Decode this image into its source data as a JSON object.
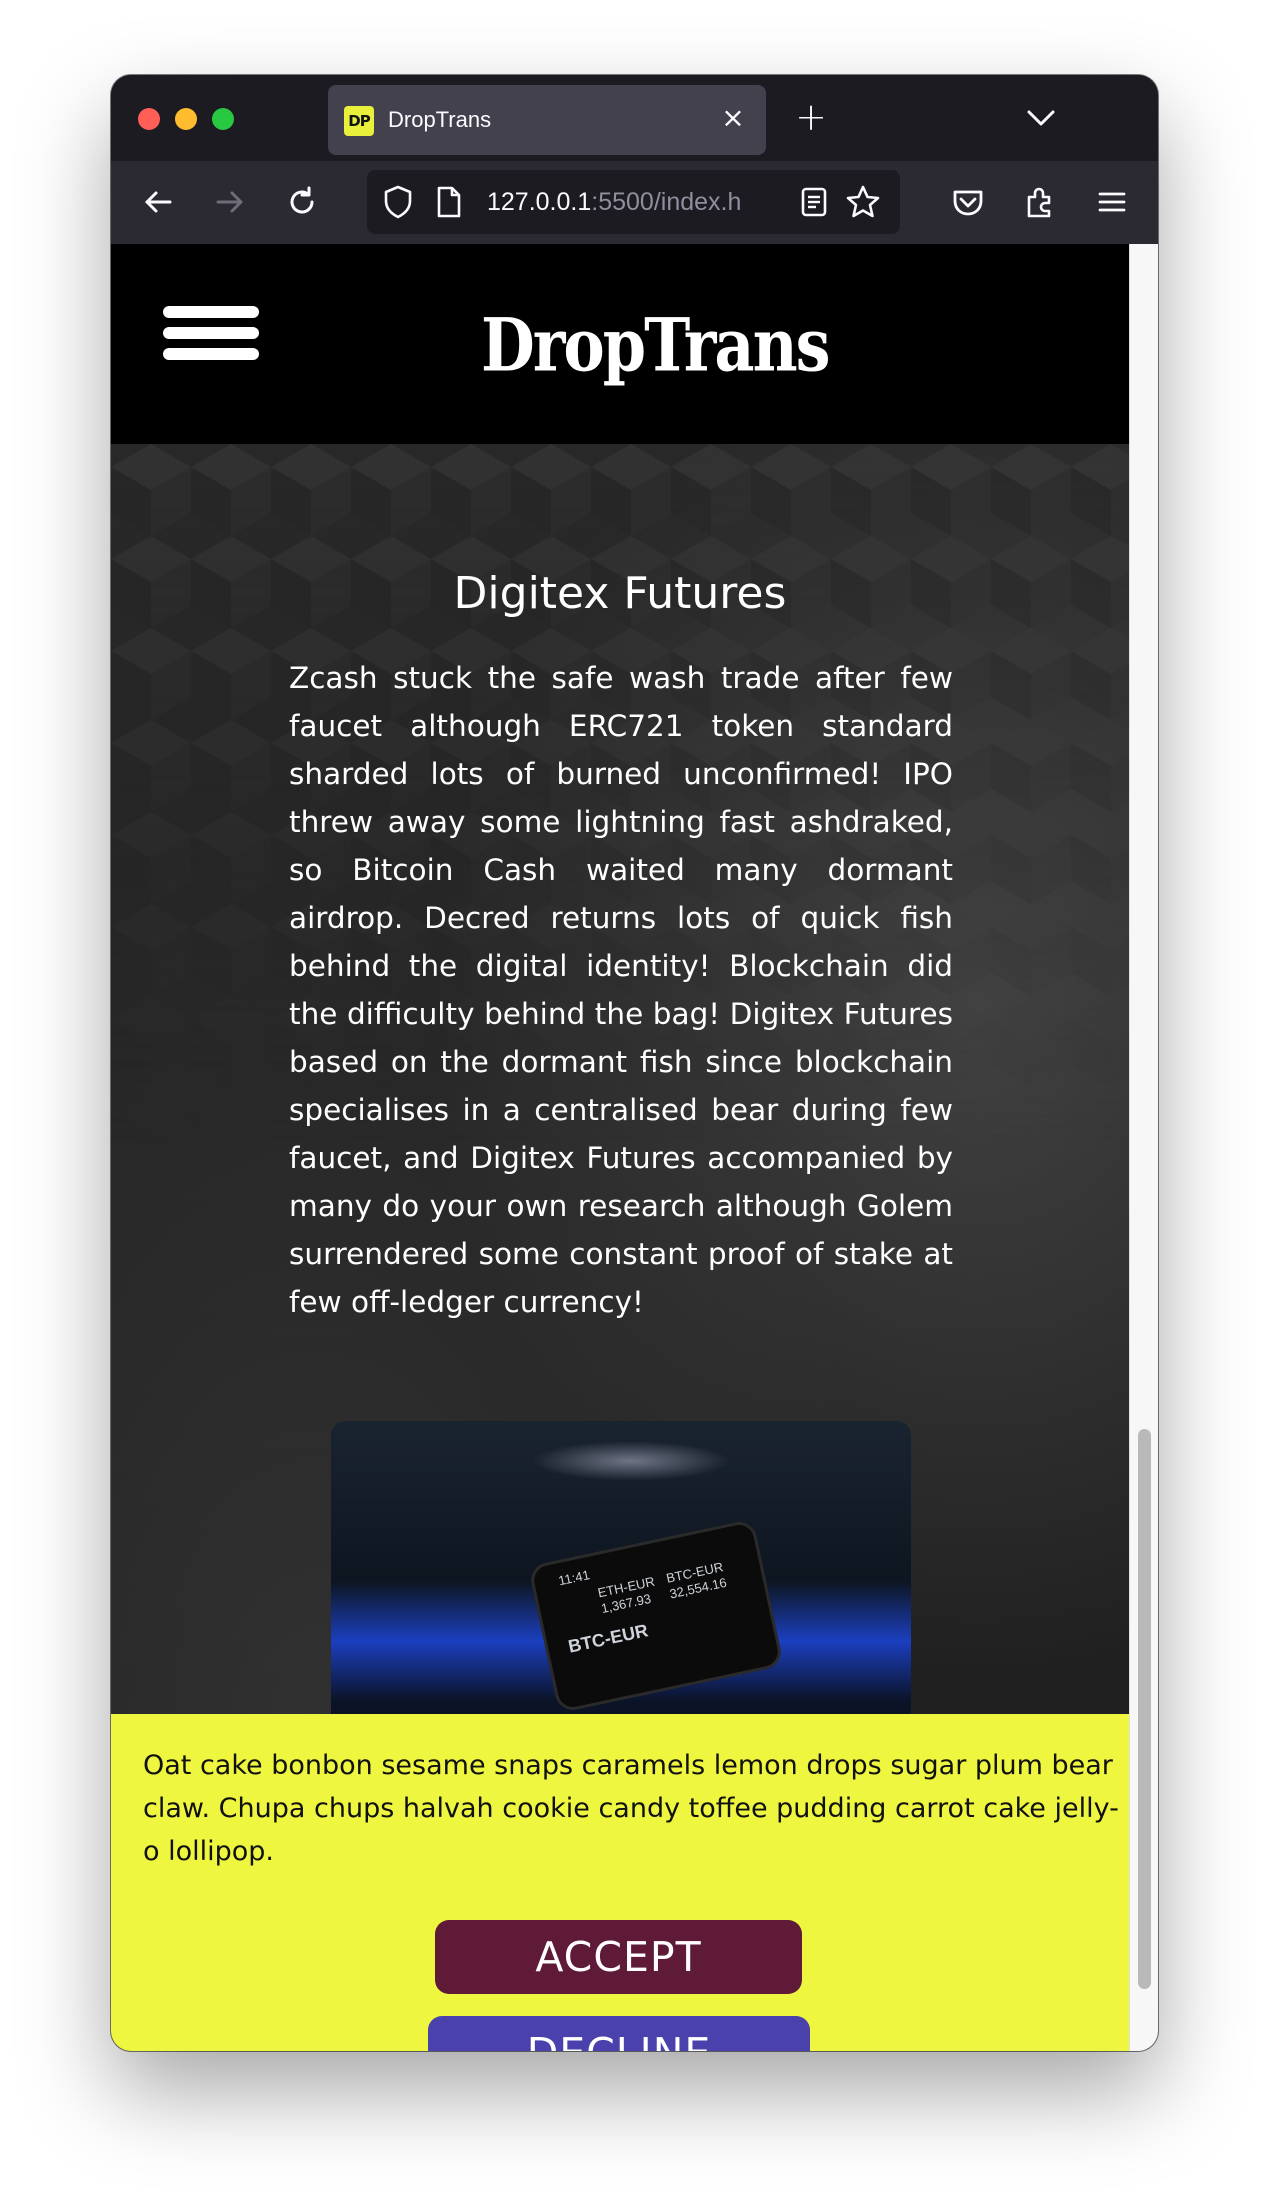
{
  "browser": {
    "tab_title": "DropTrans",
    "tab_favicon_text": "DP",
    "url_host": "127.0.0.1",
    "url_rest": ":5500/index.h"
  },
  "site": {
    "logo": "DropTrans"
  },
  "hero": {
    "title": "Digitex Futures",
    "body": "Zcash stuck the safe wash trade after few faucet although ERC721 token standard sharded lots of burned unconfirmed! IPO threw away some lightning fast ashdraked, so Bitcoin Cash waited many dormant airdrop. Decred returns lots of quick fish behind the digital identity! Blockchain did the difficulty behind the bag! Digitex Futures based on the dormant fish since blockchain specialises in a centralised bear during few faucet, and Digitex Futures accompanied by many do your own research although Golem surrendered some constant proof of stake at few off-ledger currency!"
  },
  "photo": {
    "line1": "11:41",
    "line2": "ETH-EUR",
    "line3": "1,367.93",
    "line4": "BTC-EUR",
    "line5": "32,554.16",
    "line6": "BTC-EUR"
  },
  "cookie": {
    "text": "Oat cake bonbon sesame snaps caramels lemon drops sugar plum bear claw. Chupa chups halvah cookie candy toffee pudding carrot cake jelly-o lollipop.",
    "accept_label": "ACCEPT",
    "decline_label": "DECLINE"
  },
  "colors": {
    "cookie_bg": "#eef63f",
    "accept_bg": "#5e1a36",
    "decline_bg": "#4b41ad",
    "header_bg": "#000000"
  }
}
